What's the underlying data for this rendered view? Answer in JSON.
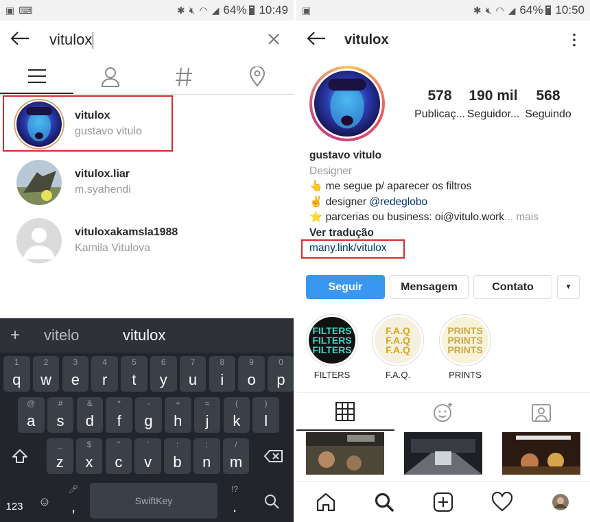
{
  "left": {
    "status": {
      "battery": "64%",
      "time": "10:49"
    },
    "search": {
      "query": "vitulox"
    },
    "tabs": [
      {
        "icon": "list-icon"
      },
      {
        "icon": "person-icon"
      },
      {
        "icon": "hashtag-icon"
      },
      {
        "icon": "location-pin-icon"
      }
    ],
    "results": [
      {
        "username": "vitulox",
        "fullname": "gustavo vitulo"
      },
      {
        "username": "vitulox.liar",
        "fullname": "m.syahendi"
      },
      {
        "username": "vituloxakamsla1988",
        "fullname": "Kamila Vitulova"
      }
    ],
    "keyboard": {
      "suggestions": [
        "vitelo",
        "vitulox"
      ],
      "row1": [
        [
          "1",
          "q"
        ],
        [
          "2",
          "w"
        ],
        [
          "3",
          "e"
        ],
        [
          "4",
          "r"
        ],
        [
          "5",
          "t"
        ],
        [
          "6",
          "y"
        ],
        [
          "7",
          "u"
        ],
        [
          "8",
          "i"
        ],
        [
          "9",
          "o"
        ],
        [
          "0",
          "p"
        ]
      ],
      "row2": [
        [
          "@",
          "a"
        ],
        [
          "#",
          "s"
        ],
        [
          "&",
          "d"
        ],
        [
          "*",
          "f"
        ],
        [
          "-",
          "g"
        ],
        [
          "+",
          "h"
        ],
        [
          "=",
          "j"
        ],
        [
          "(",
          "k"
        ],
        [
          ")",
          "l"
        ]
      ],
      "row3": [
        [
          "_",
          "z"
        ],
        [
          "$",
          "x"
        ],
        [
          "\"",
          "c"
        ],
        [
          "'",
          "v"
        ],
        [
          ":",
          "b"
        ],
        [
          ";",
          "n"
        ],
        [
          "/",
          "m"
        ]
      ],
      "bottom": {
        "numbers": "123",
        "comma": ",",
        "brand": "SwiftKey",
        "period": ".",
        "period_hint": "!?"
      }
    }
  },
  "right": {
    "status": {
      "battery": "64%",
      "time": "10:50"
    },
    "header": {
      "username": "vitulox"
    },
    "stats": [
      {
        "value": "578",
        "label": "Publicaç..."
      },
      {
        "value": "190 mil",
        "label": "Seguidor..."
      },
      {
        "value": "568",
        "label": "Seguindo"
      }
    ],
    "bio": {
      "name": "gustavo vitulo",
      "category": "Designer",
      "line1": "👆 me segue p/ aparecer os filtros",
      "line2_prefix": "✌ designer ",
      "line2_mention": "@redeglobo",
      "line3": "⭐ parcerias ou business: oi@vitulo.work",
      "line3_more": "... mais",
      "translate": "Ver tradução",
      "link": "many.link/vitulox"
    },
    "buttons": {
      "follow": "Seguir",
      "message": "Mensagem",
      "contact": "Contato"
    },
    "highlights": [
      {
        "label": "FILTERS",
        "art": "FILTERS"
      },
      {
        "label": "F.A.Q.",
        "art": "F.A.Q"
      },
      {
        "label": "PRINTS",
        "art": "PRINTS"
      }
    ]
  }
}
